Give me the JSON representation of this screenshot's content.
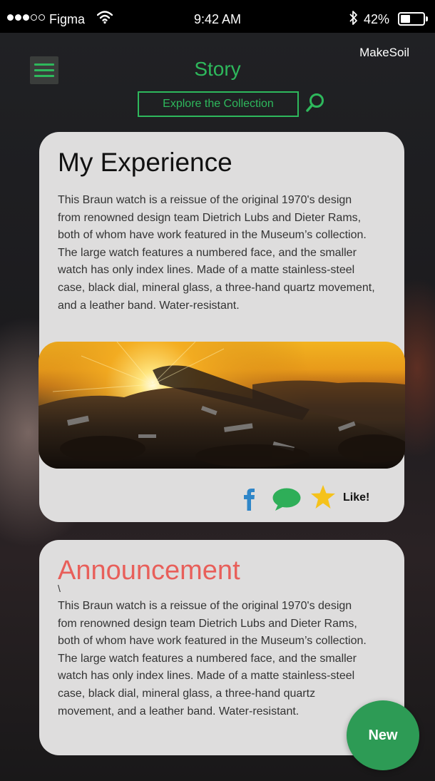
{
  "status_bar": {
    "carrier": "Figma",
    "time": "9:42 AM",
    "battery_text": "42%",
    "battery_level": 0.42,
    "signal_bars_filled": 3,
    "signal_bars_total": 5
  },
  "header": {
    "brand": "MakeSoil",
    "title": "Story",
    "explore_button": "Explore the Collection",
    "accent_color": "#2eb85c"
  },
  "cards": [
    {
      "title": "My Experience",
      "body": "This Braun watch is a reissue of the original 1970's design from renowned design team Dietrich Lubs and Dieter Rams, both of whom have work featured in the Museum’s collection. The large watch features a numbered face, and the smaller watch has only index lines. Made of a matte stainless-steel case, black dial, mineral glass, a three-hand quartz movement, and a leather band. Water-resistant.",
      "actions": {
        "like_label": "Like!",
        "icons": [
          "facebook-icon",
          "chat-bubble-icon",
          "star-icon"
        ]
      }
    },
    {
      "title": "Announcement",
      "stray_mark": "\\",
      "body": "This Braun watch is a reissue of the original 1970's design fom renowned design team Dietrich Lubs and Dieter Rams, both of whom have work featured in the Museum’s collection. The large watch features a numbered face, and the smaller watch has only index lines. Made of a matte stainless-steel case, black dial, mineral glass, a three-hand quartz movement, and a leather band. Water-resistant.",
      "title_color": "#e85f5a"
    }
  ],
  "fab": {
    "label": "New",
    "color": "#2d9b55"
  }
}
